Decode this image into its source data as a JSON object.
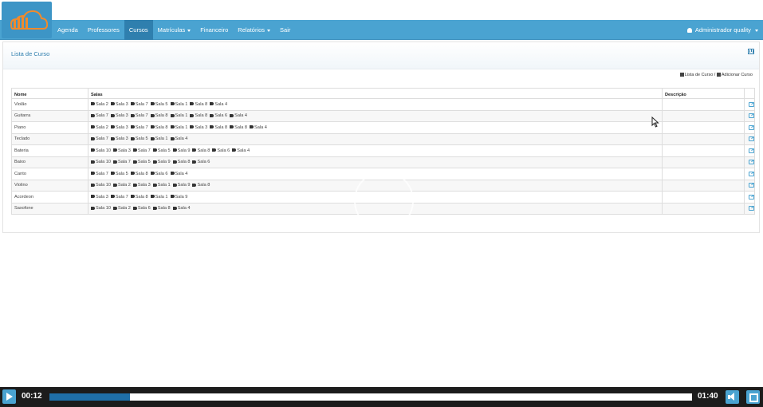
{
  "nav": {
    "items": [
      {
        "label": "Agenda",
        "active": false,
        "dropdown": false
      },
      {
        "label": "Professores",
        "active": false,
        "dropdown": false
      },
      {
        "label": "Cursos",
        "active": true,
        "dropdown": false
      },
      {
        "label": "Matrículas",
        "active": false,
        "dropdown": true
      },
      {
        "label": "Financeiro",
        "active": false,
        "dropdown": false
      },
      {
        "label": "Relatórios",
        "active": false,
        "dropdown": true
      },
      {
        "label": "Sair",
        "active": false,
        "dropdown": false
      }
    ],
    "user_label": "Administrador quality",
    "brand_color": "#4aa3d1"
  },
  "panel": {
    "title": "Lista de Curso",
    "breadcrumb_list": "Lista de Curso",
    "breadcrumb_sep": "/",
    "breadcrumb_add": "Adicionar Curso"
  },
  "table": {
    "headers": {
      "nome": "Nome",
      "salas": "Salas",
      "descricao": "Descrição"
    },
    "rows": [
      {
        "nome": "Violão",
        "salas": [
          "Sala 2",
          "Sala 3",
          "Sala 7",
          "Sala 5",
          "Sala 1",
          "Sala 8",
          "Sala 4"
        ]
      },
      {
        "nome": "Guitarra",
        "salas": [
          "Sala 7",
          "Sala 3",
          "Sala 7",
          "Sala 8",
          "Sala 1",
          "Sala 8",
          "Sala 6",
          "Sala 4"
        ]
      },
      {
        "nome": "Piano",
        "salas": [
          "Sala 2",
          "Sala 3",
          "Sala 7",
          "Sala 8",
          "Sala 1",
          "Sala 3",
          "Sala 8",
          "Sala 8",
          "Sala 4"
        ]
      },
      {
        "nome": "Teclado",
        "salas": [
          "Sala 7",
          "Sala 3",
          "Sala 5",
          "Sala 1",
          "Sala 4"
        ]
      },
      {
        "nome": "Bateria",
        "salas": [
          "Sala 10",
          "Sala 3",
          "Sala 7",
          "Sala 5",
          "Sala 9",
          "Sala 8",
          "Sala 6",
          "Sala 4"
        ]
      },
      {
        "nome": "Baixo",
        "salas": [
          "Sala 10",
          "Sala 7",
          "Sala 5",
          "Sala 9",
          "Sala 8",
          "Sala 6"
        ]
      },
      {
        "nome": "Canto",
        "salas": [
          "Sala 7",
          "Sala 5",
          "Sala 8",
          "Sala 6",
          "Sala 4"
        ]
      },
      {
        "nome": "Violino",
        "salas": [
          "Sala 10",
          "Sala 2",
          "Sala 3",
          "Sala 1",
          "Sala 9",
          "Sala 8"
        ]
      },
      {
        "nome": "Acordeon",
        "salas": [
          "Sala 3",
          "Sala 7",
          "Sala 8",
          "Sala 1",
          "Sala 9"
        ]
      },
      {
        "nome": "Saxofone",
        "salas": [
          "Sala 10",
          "Sala 2",
          "Sala 6",
          "Sala 8",
          "Sala 4"
        ]
      }
    ]
  },
  "video": {
    "current_time": "00:12",
    "total_time": "01:40",
    "progress": 0.125
  }
}
